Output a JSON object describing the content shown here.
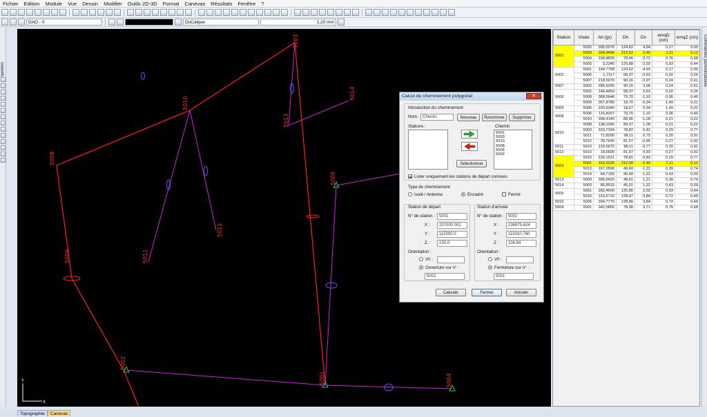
{
  "menu": [
    "Fichier",
    "Edition",
    "Module",
    "Vue",
    "Dessin",
    "Modifier",
    "Outils 2D-3D",
    "Format",
    "Canevas",
    "Résultats",
    "Fenêtre",
    "?"
  ],
  "toolbar2": {
    "layer": "DAO - 0",
    "linetype": "DuCalque",
    "lineweight": "1,20 mm"
  },
  "left_panel_tab": "Propriétés",
  "right_panel_tab": "Commandes personnalisées",
  "bottom_tabs": [
    "Topographie",
    "Canevas"
  ],
  "canvas": {
    "background": "#000000",
    "station_labels": [
      "5003",
      "5014",
      "5013",
      "5010",
      "5008",
      "5005",
      "5012",
      "5011",
      "5009",
      "5002",
      "5001",
      "5004"
    ]
  },
  "dialog": {
    "title": "Calcul de cheminement polygonal",
    "section_intro": "Introduction du cheminement",
    "nom_label": "Nom :",
    "nom_value": "Chemin",
    "btn_nouveau": "Nouveau",
    "btn_renommer": "Renommer",
    "btn_supprimer": "Supprimer",
    "stations_label": "Stations :",
    "chemin_label": "Chemin",
    "chemin_list": [
      "5001",
      "5003",
      "5010",
      "5008",
      "5006",
      "5002"
    ],
    "btn_selectionner": "Sélectionner",
    "check_lister": "Lister uniquement les stations de départ connues",
    "section_type": "Type de cheminement",
    "type_isole": "Isolé / Antenne",
    "type_encadre": "Encadré",
    "type_ferme": "Fermé",
    "depart": {
      "title": "Station de départ",
      "num_label": "N° de station :",
      "num": "5001",
      "x": "237000.002",
      "y": "115000.0",
      "z": "100.0",
      "orient_label": "Orientation :",
      "v0": "V0 :",
      "option": "Ouverture sur n° :",
      "sel": "5002"
    },
    "arrivee": {
      "title": "Station d'arrivée",
      "num_label": "N° de station :",
      "num": "5002",
      "x": "236875.624",
      "y": "115010.760",
      "z": "104.94",
      "orient_label": "Orientation :",
      "v0": "V0 :",
      "option": "Fermeture sur n° :",
      "sel": "5001"
    },
    "xl": "X :",
    "yl": "Y :",
    "zl": "Z :",
    "btn_calculer": "Calculer",
    "btn_fermer": "Fermer",
    "btn_annuler": "Annuler"
  },
  "table": {
    "headers": [
      "Station",
      "Visée",
      "Ah (gr)",
      "Dh",
      "Dn",
      "emqD (cm)",
      "emqZ (cm)"
    ],
    "groups": [
      {
        "station": "5001",
        "highlight": true,
        "rows": [
          [
            "5002",
            "305,5076",
            "124,62",
            "4,94",
            "0,17",
            "0,00"
          ],
          [
            "5003",
            "394,9496",
            "212,52",
            "2,45",
            "1,11",
            "0,12"
          ],
          [
            "5004",
            "199,4820",
            "78,46",
            "-3,72",
            "0,76",
            "0,68"
          ],
          [
            "5005",
            "3,2345",
            "125,88",
            "-2,02",
            "0,93",
            "0,44"
          ]
        ],
        "hl_rows": [
          1
        ]
      },
      {
        "station": "5002",
        "rows": [
          [
            "5001",
            "144,7768",
            "124,62",
            "-4,93",
            "0,17",
            "0,00"
          ],
          [
            "5006",
            "1,7117",
            "58,37",
            "-0,53",
            "0,02",
            "0,26"
          ],
          [
            "5007",
            "218,5970",
            "90,16",
            "-3,97",
            "0,24",
            "0,61"
          ]
        ]
      },
      {
        "station": "5007",
        "rows": [
          [
            "5002",
            "285,9200",
            "90,15",
            "3,96",
            "0,24",
            "0,61"
          ]
        ]
      },
      {
        "station": "5006",
        "rows": [
          [
            "5002",
            "140,4459",
            "58,37",
            "0,53",
            "0,02",
            "0,26"
          ],
          [
            "5008",
            "368,5646",
            "79,70",
            "-1,10",
            "0,06",
            "0,40"
          ],
          [
            "5009",
            "367,8780",
            "18,70",
            "-0,34",
            "1,49",
            "0,31"
          ]
        ]
      },
      {
        "station": "5009",
        "rows": [
          [
            "5006",
            "203,9340",
            "18,67",
            "0,34",
            "1,49",
            "0,31"
          ]
        ]
      },
      {
        "station": "5008",
        "rows": [
          [
            "5006",
            "115,8207",
            "79,70",
            "1,10",
            "0,06",
            "0,40"
          ],
          [
            "5010",
            "398,4145",
            "89,96",
            "-1,28",
            "0,21",
            "0,22"
          ]
        ]
      },
      {
        "station": "5010",
        "rows": [
          [
            "5008",
            "138,1040",
            "89,97",
            "1,28",
            "0,21",
            "0,22"
          ],
          [
            "5003",
            "323,7194",
            "78,82",
            "0,42",
            "0,29",
            "0,77"
          ],
          [
            "5011",
            "71,8290",
            "98,11",
            "0,75",
            "0,20",
            "0,91"
          ],
          [
            "5012",
            "30,7645",
            "81,57",
            "-0,95",
            "0,27",
            "0,92"
          ]
        ]
      },
      {
        "station": "5011",
        "rows": [
          [
            "5010",
            "120,5675",
            "98,11",
            "-0,77",
            "0,20",
            "0,91"
          ]
        ]
      },
      {
        "station": "5012",
        "rows": [
          [
            "5010",
            "18,6605",
            "81,57",
            "0,93",
            "0,27",
            "0,92"
          ]
        ]
      },
      {
        "station": "5003",
        "highlight": true,
        "rows": [
          [
            "5010",
            "226,1521",
            "78,81",
            "-0,43",
            "0,29",
            "0,77"
          ],
          [
            "5001",
            "153,3326",
            "212,50",
            "-2,45",
            "1,11",
            "0,12"
          ],
          [
            "5013",
            "167,0596",
            "49,60",
            "-1,22",
            "0,39",
            "0,74"
          ],
          [
            "5014",
            "69,7165",
            "45,00",
            "-1,22",
            "0,43",
            "0,09"
          ]
        ],
        "hl_rows": [
          1
        ]
      },
      {
        "station": "5013",
        "rows": [
          [
            "5003",
            "395,5420",
            "49,61",
            "1,21",
            "0,39",
            "0,74"
          ]
        ]
      },
      {
        "station": "5014",
        "rows": [
          [
            "5003",
            "86,8510",
            "45,01",
            "1,22",
            "0,43",
            "0,09"
          ]
        ]
      },
      {
        "station": "5005",
        "rows": [
          [
            "5001",
            "282,4600",
            "125,86",
            "2,02",
            "0,93",
            "0,44"
          ],
          [
            "5015",
            "163,5710",
            "128,47",
            "-3,84",
            "0,72",
            "0,49"
          ]
        ]
      },
      {
        "station": "5015",
        "rows": [
          [
            "5005",
            "394,7770",
            "128,46",
            "3,84",
            "0,72",
            "0,49"
          ]
        ]
      },
      {
        "station": "5004",
        "rows": [
          [
            "5001",
            "342,5855",
            "78,38",
            "3,71",
            "0,76",
            "0,68"
          ]
        ]
      }
    ]
  },
  "colors": {
    "path_red": "#ff2020",
    "visee_magenta": "#cc22dd",
    "visee_blue": "#5a5aff",
    "highlight": "#ffff00",
    "station_green": "#2ecc40"
  }
}
